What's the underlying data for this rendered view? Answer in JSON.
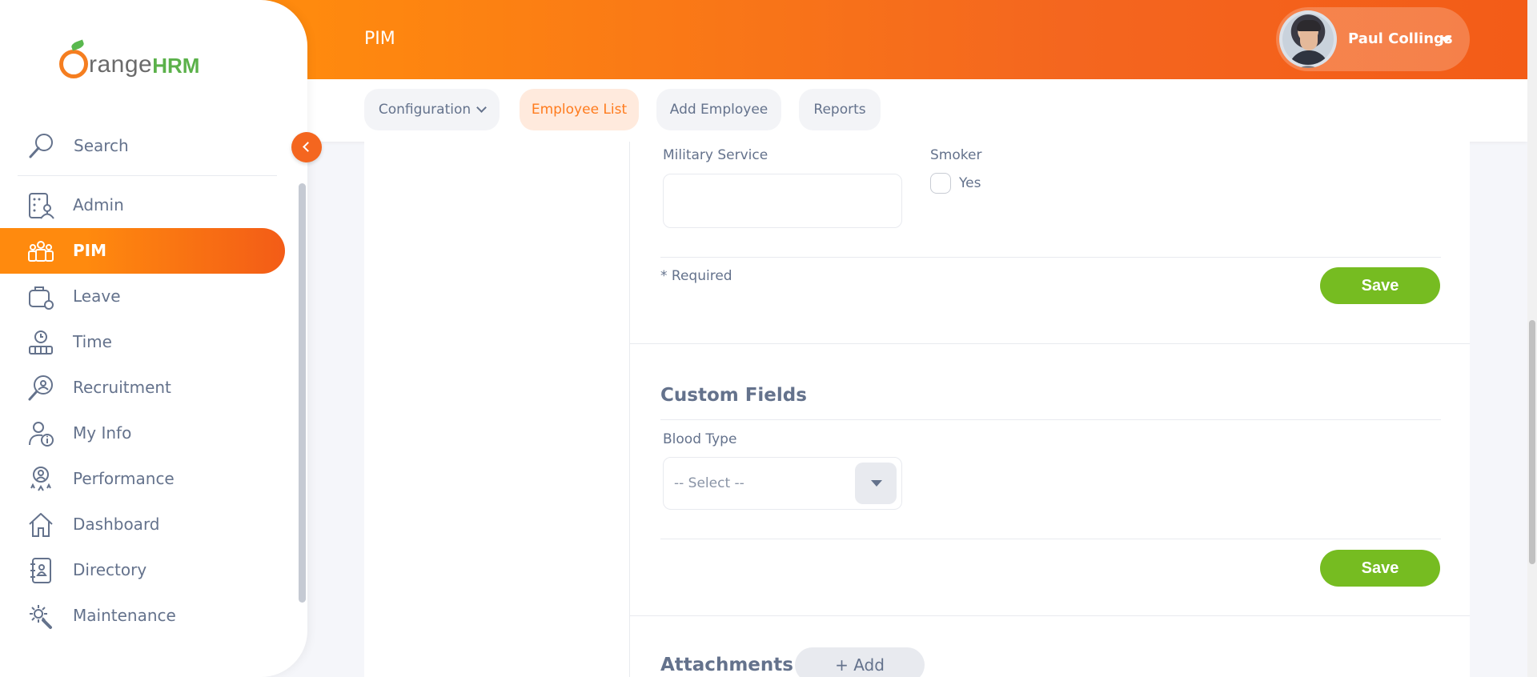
{
  "header": {
    "module_title": "PIM",
    "user_name": "Paul Collings"
  },
  "subnav": {
    "tabs": [
      {
        "label": "Configuration",
        "has_dropdown": true,
        "active": false
      },
      {
        "label": "Employee List",
        "active": true
      },
      {
        "label": "Add Employee",
        "active": false
      },
      {
        "label": "Reports",
        "active": false
      }
    ]
  },
  "form": {
    "military_service_label": "Military Service",
    "military_service_value": "",
    "smoker_label": "Smoker",
    "smoker_option_label": "Yes",
    "smoker_checked": false,
    "required_note": "* Required",
    "save_label": "Save"
  },
  "custom_fields": {
    "title": "Custom Fields",
    "blood_type_label": "Blood Type",
    "blood_type_placeholder": "-- Select --",
    "save_label": "Save"
  },
  "attachments": {
    "title": "Attachments",
    "add_label": "+ Add"
  },
  "sidebar": {
    "search_label": "Search",
    "items": [
      {
        "label": "Admin",
        "icon": "admin-icon"
      },
      {
        "label": "PIM",
        "icon": "pim-icon",
        "active": true
      },
      {
        "label": "Leave",
        "icon": "leave-icon"
      },
      {
        "label": "Time",
        "icon": "time-icon"
      },
      {
        "label": "Recruitment",
        "icon": "recruitment-icon"
      },
      {
        "label": "My Info",
        "icon": "my-info-icon"
      },
      {
        "label": "Performance",
        "icon": "performance-icon"
      },
      {
        "label": "Dashboard",
        "icon": "dashboard-icon"
      },
      {
        "label": "Directory",
        "icon": "directory-icon"
      },
      {
        "label": "Maintenance",
        "icon": "maintenance-icon"
      }
    ]
  },
  "brand": {
    "logo_word": "range",
    "logo_suffix": "HRM",
    "accent_color": "#ff7b1d",
    "save_color": "#76bc21"
  }
}
